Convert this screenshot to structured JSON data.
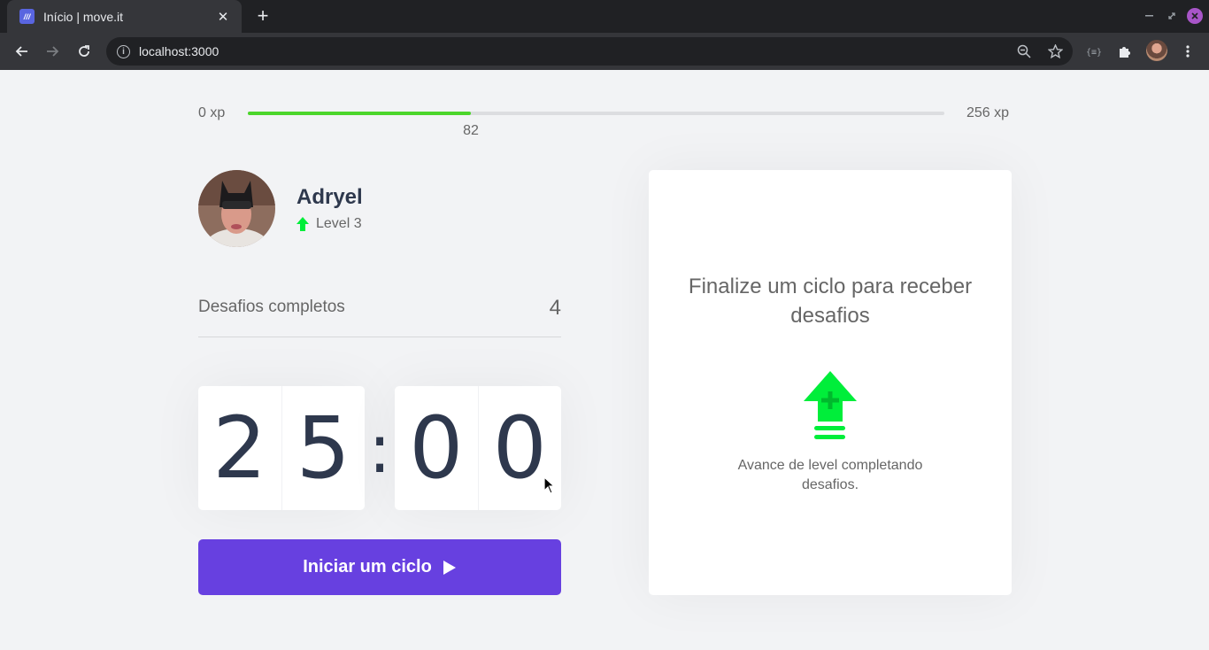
{
  "browser": {
    "tab_title": "Início | move.it",
    "favicon_text": "///",
    "url": "localhost:3000"
  },
  "experience": {
    "min_label": "0 xp",
    "max_label": "256 xp",
    "current_label": "82",
    "current_value": 82,
    "max_value": 256
  },
  "profile": {
    "name": "Adryel",
    "level_label": "Level 3"
  },
  "challenges": {
    "label": "Desafios completos",
    "count": "4"
  },
  "countdown": {
    "minute_left": "2",
    "minute_right": "5",
    "separator": ":",
    "second_left": "0",
    "second_right": "0"
  },
  "start_button": {
    "label": "Iniciar um ciclo"
  },
  "challenge_box": {
    "headline": "Finalize um ciclo para receber desafios",
    "hint": "Avance de level completando desafios."
  },
  "colors": {
    "accent": "#6740e0",
    "xp_bar": "#4cd62b",
    "level_up_green": "#00ee3a",
    "text": "#666666",
    "title": "#2e384d",
    "background": "#f2f3f5"
  }
}
